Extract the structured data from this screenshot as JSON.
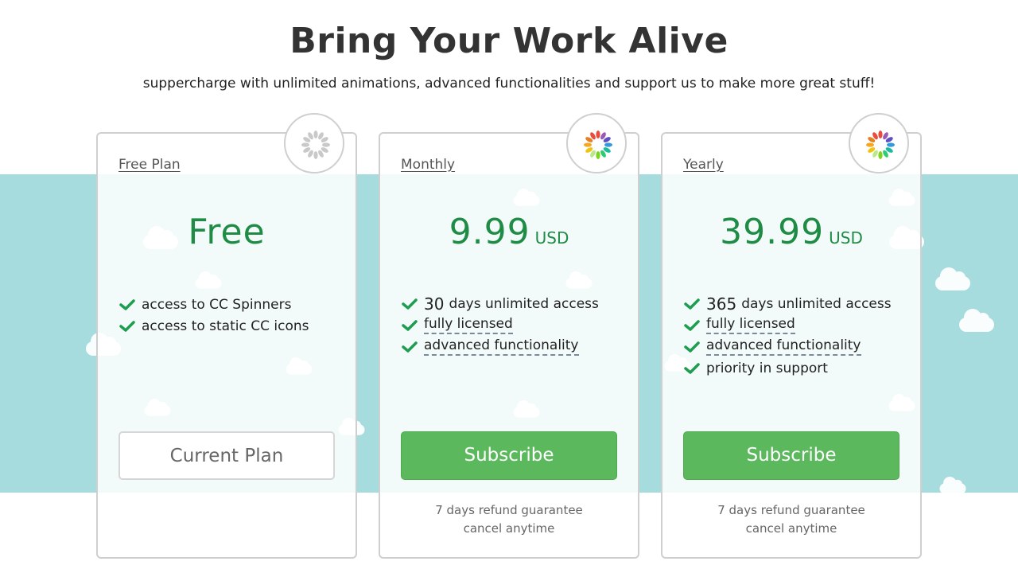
{
  "header": {
    "title": "Bring Your Work Alive",
    "subtitle": "suppercharge with unlimited animations, advanced functionalities and support us to make more great stuff!"
  },
  "plans": [
    {
      "name": "Free Plan",
      "price": "Free",
      "features": [
        {
          "text": "access to CC Spinners"
        },
        {
          "text": "access to static CC icons"
        }
      ],
      "button_label": "Current Plan"
    },
    {
      "name": "Monthly",
      "price": "9.99",
      "unit": "USD",
      "features": [
        {
          "num": "30",
          "text": "days unlimited access"
        },
        {
          "text": "fully licensed"
        },
        {
          "text": "advanced functionality"
        }
      ],
      "button_label": "Subscribe",
      "note_line1": "7 days refund guarantee",
      "note_line2": "cancel anytime"
    },
    {
      "name": "Yearly",
      "price": "39.99",
      "unit": "USD",
      "features": [
        {
          "num": "365",
          "text": "days unlimited access"
        },
        {
          "text": "fully licensed"
        },
        {
          "text": "advanced functionality"
        },
        {
          "text": "priority in support"
        }
      ],
      "button_label": "Subscribe",
      "note_line1": "7 days refund guarantee",
      "note_line2": "cancel anytime"
    }
  ],
  "icons": {
    "check": "check-icon",
    "spinner_gray": "spinner-gray-icon",
    "spinner_color": "spinner-color-icon"
  },
  "colors": {
    "accent_green": "#1e8c45",
    "button_green": "#5bb85d",
    "band": "#a7dcdf"
  }
}
